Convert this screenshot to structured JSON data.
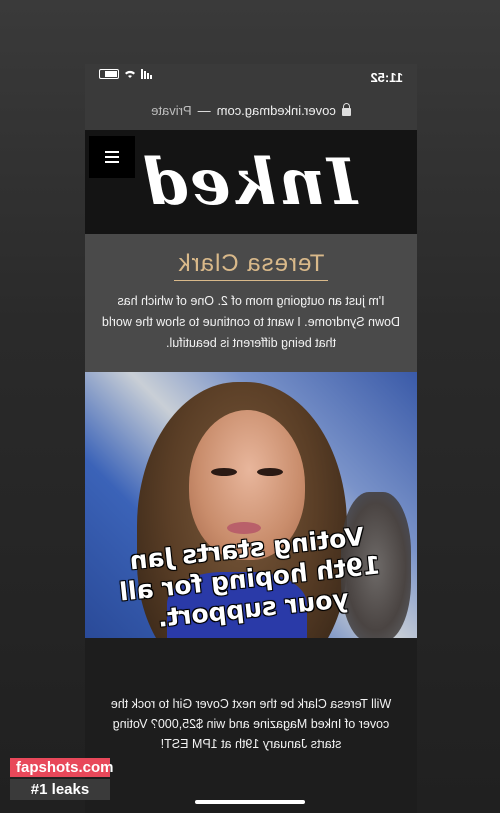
{
  "statusbar": {
    "time": "11:52"
  },
  "browser": {
    "url": "cover.inkedmag.com",
    "separator": " — ",
    "mode": "Private"
  },
  "site": {
    "logo": "Inked"
  },
  "profile": {
    "name": "Teresa Clark",
    "bio": "I'm just an outgoing mom of 2. One of which has Down Syndrome. I want to continue to show the world that being different is beautiful."
  },
  "caption": {
    "line1": "Voting starts Jan",
    "line2": "19th hoping for all",
    "line3": "your support."
  },
  "cta": {
    "text": "Will Teresa Clark be the next Cover Girl to rock the cover of Inked Magazine and win $25,000? Voting starts January 19th at 1PM EST!"
  },
  "watermark": {
    "site": "fapshots.com",
    "tag": "#1 leaks"
  },
  "colors": {
    "accent": "#d9b98a",
    "watermark": "#e8485a"
  }
}
